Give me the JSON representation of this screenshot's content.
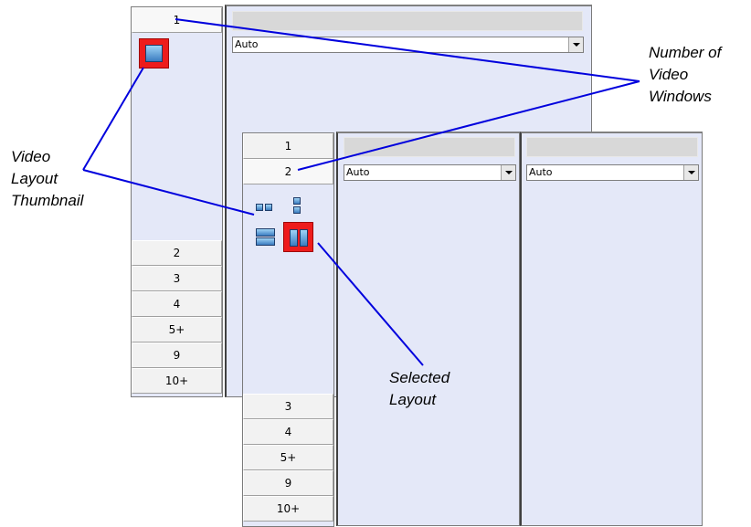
{
  "back_window": {
    "tabs": [
      "1",
      "2",
      "3",
      "4",
      "5+",
      "9",
      "10+"
    ],
    "dropdown_value": "Auto"
  },
  "front_window": {
    "tabs": [
      "1",
      "2",
      "3",
      "4",
      "5+",
      "9",
      "10+"
    ],
    "dropdown_left_value": "Auto",
    "dropdown_right_value": "Auto"
  },
  "callouts": {
    "number_of_windows": [
      "Number of",
      "Video",
      "Windows"
    ],
    "layout_thumbnail": [
      "Video",
      "Layout",
      "Thumbnail"
    ],
    "selected_layout": [
      "Selected",
      "Layout"
    ]
  },
  "colors": {
    "accent_selected": "#ee1c1c",
    "callout_line": "#0000dd",
    "panel_bg": "#e4e8f8"
  }
}
